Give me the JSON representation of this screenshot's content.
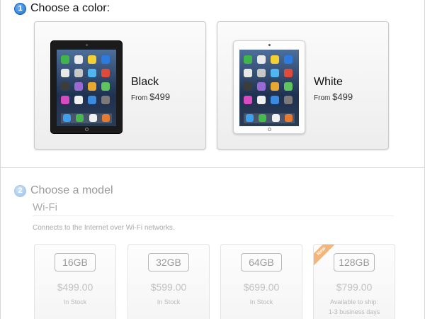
{
  "step1": {
    "number": "1",
    "title": "Choose a color:"
  },
  "colors": [
    {
      "name": "Black",
      "from": "From",
      "price": "$499"
    },
    {
      "name": "White",
      "from": "From",
      "price": "$499"
    }
  ],
  "step2": {
    "number": "2",
    "title": "Choose a model"
  },
  "model": {
    "name": "Wi-Fi",
    "description": "Connects to the Internet over Wi-Fi networks.",
    "capacities": [
      {
        "size": "16GB",
        "price": "$499.00",
        "stock": "In Stock"
      },
      {
        "size": "32GB",
        "price": "$599.00",
        "stock": "In Stock"
      },
      {
        "size": "64GB",
        "price": "$699.00",
        "stock": "In Stock"
      },
      {
        "size": "128GB",
        "price": "$799.00",
        "stock": "Available to ship:",
        "stock2": "1-3 business days",
        "badge": "New"
      }
    ]
  },
  "colors_theme": {
    "accent_blue": "#1a6fd0",
    "new_badge": "#f2b57c"
  }
}
